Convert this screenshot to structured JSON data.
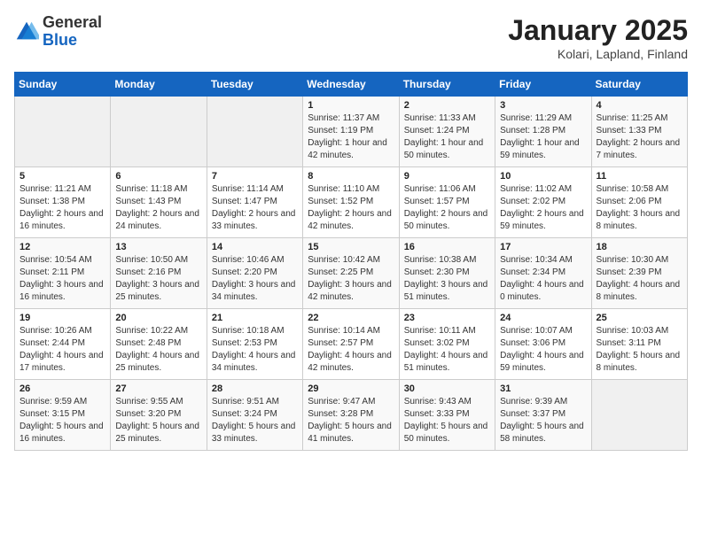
{
  "header": {
    "logo_general": "General",
    "logo_blue": "Blue",
    "title": "January 2025",
    "subtitle": "Kolari, Lapland, Finland"
  },
  "weekdays": [
    "Sunday",
    "Monday",
    "Tuesday",
    "Wednesday",
    "Thursday",
    "Friday",
    "Saturday"
  ],
  "weeks": [
    [
      {
        "day": "",
        "info": ""
      },
      {
        "day": "",
        "info": ""
      },
      {
        "day": "",
        "info": ""
      },
      {
        "day": "1",
        "info": "Sunrise: 11:37 AM\nSunset: 1:19 PM\nDaylight: 1 hour and 42 minutes."
      },
      {
        "day": "2",
        "info": "Sunrise: 11:33 AM\nSunset: 1:24 PM\nDaylight: 1 hour and 50 minutes."
      },
      {
        "day": "3",
        "info": "Sunrise: 11:29 AM\nSunset: 1:28 PM\nDaylight: 1 hour and 59 minutes."
      },
      {
        "day": "4",
        "info": "Sunrise: 11:25 AM\nSunset: 1:33 PM\nDaylight: 2 hours and 7 minutes."
      }
    ],
    [
      {
        "day": "5",
        "info": "Sunrise: 11:21 AM\nSunset: 1:38 PM\nDaylight: 2 hours and 16 minutes."
      },
      {
        "day": "6",
        "info": "Sunrise: 11:18 AM\nSunset: 1:43 PM\nDaylight: 2 hours and 24 minutes."
      },
      {
        "day": "7",
        "info": "Sunrise: 11:14 AM\nSunset: 1:47 PM\nDaylight: 2 hours and 33 minutes."
      },
      {
        "day": "8",
        "info": "Sunrise: 11:10 AM\nSunset: 1:52 PM\nDaylight: 2 hours and 42 minutes."
      },
      {
        "day": "9",
        "info": "Sunrise: 11:06 AM\nSunset: 1:57 PM\nDaylight: 2 hours and 50 minutes."
      },
      {
        "day": "10",
        "info": "Sunrise: 11:02 AM\nSunset: 2:02 PM\nDaylight: 2 hours and 59 minutes."
      },
      {
        "day": "11",
        "info": "Sunrise: 10:58 AM\nSunset: 2:06 PM\nDaylight: 3 hours and 8 minutes."
      }
    ],
    [
      {
        "day": "12",
        "info": "Sunrise: 10:54 AM\nSunset: 2:11 PM\nDaylight: 3 hours and 16 minutes."
      },
      {
        "day": "13",
        "info": "Sunrise: 10:50 AM\nSunset: 2:16 PM\nDaylight: 3 hours and 25 minutes."
      },
      {
        "day": "14",
        "info": "Sunrise: 10:46 AM\nSunset: 2:20 PM\nDaylight: 3 hours and 34 minutes."
      },
      {
        "day": "15",
        "info": "Sunrise: 10:42 AM\nSunset: 2:25 PM\nDaylight: 3 hours and 42 minutes."
      },
      {
        "day": "16",
        "info": "Sunrise: 10:38 AM\nSunset: 2:30 PM\nDaylight: 3 hours and 51 minutes."
      },
      {
        "day": "17",
        "info": "Sunrise: 10:34 AM\nSunset: 2:34 PM\nDaylight: 4 hours and 0 minutes."
      },
      {
        "day": "18",
        "info": "Sunrise: 10:30 AM\nSunset: 2:39 PM\nDaylight: 4 hours and 8 minutes."
      }
    ],
    [
      {
        "day": "19",
        "info": "Sunrise: 10:26 AM\nSunset: 2:44 PM\nDaylight: 4 hours and 17 minutes."
      },
      {
        "day": "20",
        "info": "Sunrise: 10:22 AM\nSunset: 2:48 PM\nDaylight: 4 hours and 25 minutes."
      },
      {
        "day": "21",
        "info": "Sunrise: 10:18 AM\nSunset: 2:53 PM\nDaylight: 4 hours and 34 minutes."
      },
      {
        "day": "22",
        "info": "Sunrise: 10:14 AM\nSunset: 2:57 PM\nDaylight: 4 hours and 42 minutes."
      },
      {
        "day": "23",
        "info": "Sunrise: 10:11 AM\nSunset: 3:02 PM\nDaylight: 4 hours and 51 minutes."
      },
      {
        "day": "24",
        "info": "Sunrise: 10:07 AM\nSunset: 3:06 PM\nDaylight: 4 hours and 59 minutes."
      },
      {
        "day": "25",
        "info": "Sunrise: 10:03 AM\nSunset: 3:11 PM\nDaylight: 5 hours and 8 minutes."
      }
    ],
    [
      {
        "day": "26",
        "info": "Sunrise: 9:59 AM\nSunset: 3:15 PM\nDaylight: 5 hours and 16 minutes."
      },
      {
        "day": "27",
        "info": "Sunrise: 9:55 AM\nSunset: 3:20 PM\nDaylight: 5 hours and 25 minutes."
      },
      {
        "day": "28",
        "info": "Sunrise: 9:51 AM\nSunset: 3:24 PM\nDaylight: 5 hours and 33 minutes."
      },
      {
        "day": "29",
        "info": "Sunrise: 9:47 AM\nSunset: 3:28 PM\nDaylight: 5 hours and 41 minutes."
      },
      {
        "day": "30",
        "info": "Sunrise: 9:43 AM\nSunset: 3:33 PM\nDaylight: 5 hours and 50 minutes."
      },
      {
        "day": "31",
        "info": "Sunrise: 9:39 AM\nSunset: 3:37 PM\nDaylight: 5 hours and 58 minutes."
      },
      {
        "day": "",
        "info": ""
      }
    ]
  ]
}
